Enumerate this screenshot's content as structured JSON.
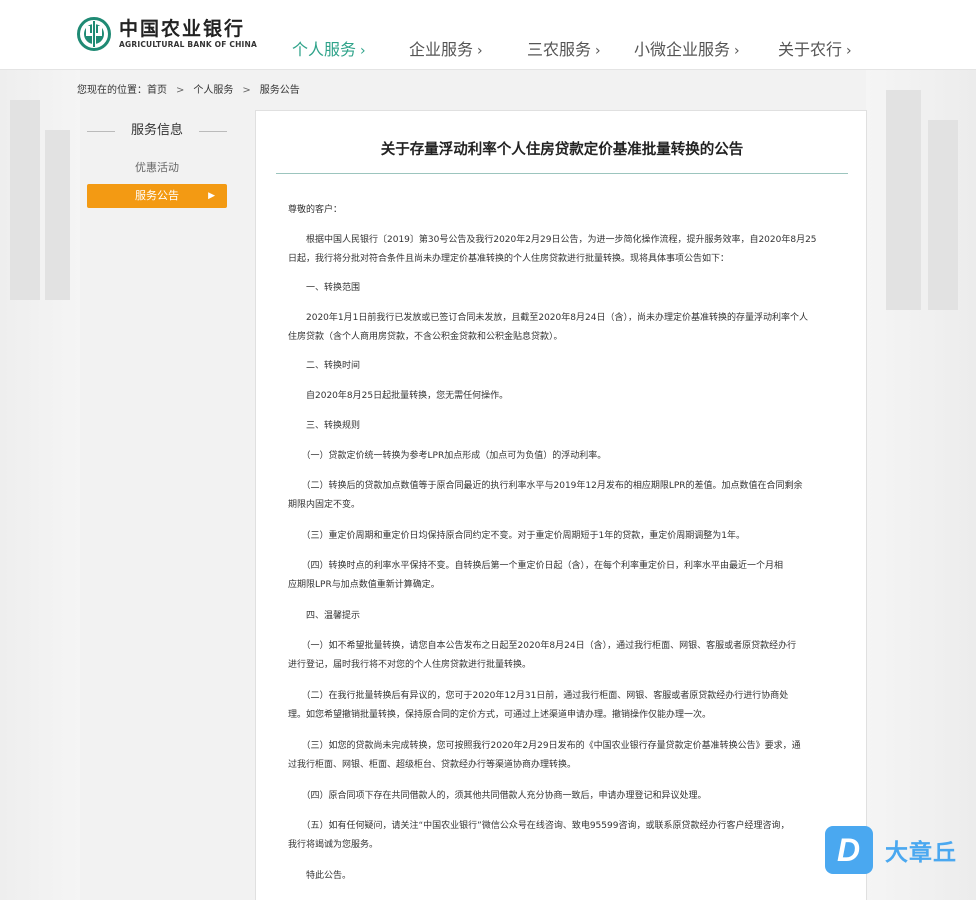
{
  "brand": {
    "name_cn": "中国农业银行",
    "name_en": "AGRICULTURAL BANK OF CHINA",
    "color": "#1f8a74"
  },
  "nav": [
    {
      "label": "个人服务",
      "active": true
    },
    {
      "label": "企业服务",
      "active": false
    },
    {
      "label": "三农服务",
      "active": false
    },
    {
      "label": "小微企业服务",
      "active": false
    },
    {
      "label": "关于农行",
      "active": false
    }
  ],
  "nav_chevron": "›",
  "breadcrumb": {
    "prefix": "您现在的位置：",
    "items": [
      "首页",
      "个人服务",
      "服务公告"
    ],
    "sep": ">"
  },
  "sidebar": {
    "title": "服务信息",
    "items": [
      "优惠活动",
      "服务公告"
    ],
    "active_index": 1,
    "active_color": "#f39a13"
  },
  "article": {
    "title": "关于存量浮动利率个人住房贷款定价基准批量转换的公告",
    "paragraphs": [
      [
        "尊敬的客户："
      ],
      [
        "　　根据中国人民银行〔2019〕第30号公告及我行2020年2月29日公告，为进一步简化操作流程，提升服务效率，自2020年8月25",
        "日起，我行将分批对符合条件且尚未办理定价基准转换的个人住房贷款进行批量转换。现将具体事项公告如下："
      ],
      [
        "　　一、转换范围"
      ],
      [
        "　　2020年1月1日前我行已发放或已签订合同未发放，且截至2020年8月24日（含），尚未办理定价基准转换的存量浮动利率个人",
        "住房贷款（含个人商用房贷款，不含公积金贷款和公积金贴息贷款）。"
      ],
      [
        "　　二、转换时间"
      ],
      [
        "　　自2020年8月25日起批量转换，您无需任何操作。"
      ],
      [
        "　　三、转换规则"
      ],
      [
        "　　（一）贷款定价统一转换为参考LPR加点形成（加点可为负值）的浮动利率。"
      ],
      [
        "　　（二）转换后的贷款加点数值等于原合同最近的执行利率水平与2019年12月发布的相应期限LPR的差值。加点数值在合同剩余",
        "期限内固定不变。"
      ],
      [
        "　　（三）重定价周期和重定价日均保持原合同约定不变。对于重定价周期短于1年的贷款，重定价周期调整为1年。"
      ],
      [
        "　　（四）转换时点的利率水平保持不变。自转换后第一个重定价日起（含），在每个利率重定价日，利率水平由最近一个月相",
        "应期限LPR与加点数值重新计算确定。"
      ],
      [
        "　　四、温馨提示"
      ],
      [
        "　　（一）如不希望批量转换，请您自本公告发布之日起至2020年8月24日（含），通过我行柜面、网银、客服或者原贷款经办行",
        "进行登记，届时我行将不对您的个人住房贷款进行批量转换。"
      ],
      [
        "　　（二）在我行批量转换后有异议的，您可于2020年12月31日前，通过我行柜面、网银、客服或者原贷款经办行进行协商处",
        "理。如您希望撤销批量转换，保持原合同的定价方式，可通过上述渠道申请办理。撤销操作仅能办理一次。"
      ],
      [
        "　　（三）如您的贷款尚未完成转换，您可按照我行2020年2月29日发布的《中国农业银行存量贷款定价基准转换公告》要求，通",
        "过我行柜面、网银、柜面、超级柜台、贷款经办行等渠道协商办理转换。"
      ],
      [
        "　　（四）原合同项下存在共同借款人的，须其他共同借款人充分协商一致后，申请办理登记和异议处理。"
      ],
      [
        "　　（五）如有任何疑问，请关注“中国农业银行”微信公众号在线咨询、致电95599咨询，或联系原贷款经办行客户经理咨询，",
        "我行将竭诚为您服务。"
      ],
      [
        "　　特此公告。"
      ]
    ]
  },
  "watermark": {
    "icon_letter": "D",
    "text": "大章丘",
    "color": "#4aa8f0"
  }
}
